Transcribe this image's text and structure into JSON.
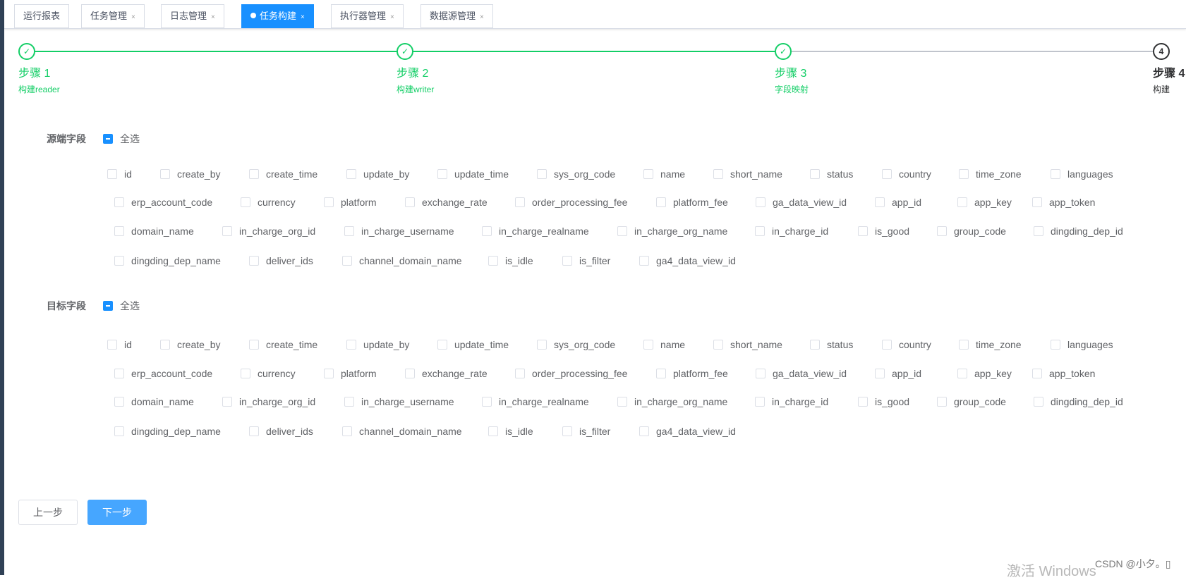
{
  "tabs": [
    {
      "label": "运行报表",
      "closable": false,
      "active": false
    },
    {
      "label": "任务管理",
      "closable": true,
      "active": false
    },
    {
      "label": "日志管理",
      "closable": true,
      "active": false
    },
    {
      "label": "任务构建",
      "closable": true,
      "active": true
    },
    {
      "label": "执行器管理",
      "closable": true,
      "active": false
    },
    {
      "label": "数据源管理",
      "closable": true,
      "active": false
    }
  ],
  "tab_close_glyph": "×",
  "steps": [
    {
      "title": "步骤 1",
      "description": "构建reader",
      "status": "finish"
    },
    {
      "title": "步骤 2",
      "description": "构建writer",
      "status": "finish"
    },
    {
      "title": "步骤 3",
      "description": "字段映射",
      "status": "finish"
    },
    {
      "title": "步骤 4",
      "description": "构建",
      "status": "process",
      "number": "4"
    }
  ],
  "colors": {
    "success": "#13ce66",
    "primary": "#1890ff",
    "button_primary": "#46a6ff"
  },
  "source": {
    "label": "源端字段",
    "check_all_label": "全选",
    "check_all_state": "indeterminate",
    "fields": [
      [
        "id",
        "create_by",
        "create_time",
        "update_by",
        "update_time",
        "sys_org_code",
        "name",
        "short_name",
        "status",
        "country",
        "time_zone",
        "languages"
      ],
      [
        "erp_account_code",
        "currency",
        "platform",
        "exchange_rate",
        "order_processing_fee",
        "platform_fee",
        "ga_data_view_id",
        "app_id",
        "app_key",
        "app_token"
      ],
      [
        "domain_name",
        "in_charge_org_id",
        "in_charge_username",
        "in_charge_realname",
        "in_charge_org_name",
        "in_charge_id",
        "is_good",
        "group_code",
        "dingding_dep_id"
      ],
      [
        "dingding_dep_name",
        "deliver_ids",
        "channel_domain_name",
        "is_idle",
        "is_filter",
        "ga4_data_view_id"
      ]
    ]
  },
  "target": {
    "label": "目标字段",
    "check_all_label": "全选",
    "check_all_state": "indeterminate",
    "fields": [
      [
        "id",
        "create_by",
        "create_time",
        "update_by",
        "update_time",
        "sys_org_code",
        "name",
        "short_name",
        "status",
        "country",
        "time_zone",
        "languages"
      ],
      [
        "erp_account_code",
        "currency",
        "platform",
        "exchange_rate",
        "order_processing_fee",
        "platform_fee",
        "ga_data_view_id",
        "app_id",
        "app_key",
        "app_token"
      ],
      [
        "domain_name",
        "in_charge_org_id",
        "in_charge_username",
        "in_charge_realname",
        "in_charge_org_name",
        "in_charge_id",
        "is_good",
        "group_code",
        "dingding_dep_id"
      ],
      [
        "dingding_dep_name",
        "deliver_ids",
        "channel_domain_name",
        "is_idle",
        "is_filter",
        "ga4_data_view_id"
      ]
    ]
  },
  "buttons": {
    "prev": "上一步",
    "next": "下一步"
  },
  "watermarks": {
    "windows": "激活 Windows",
    "csdn": "CSDN @小夕。▯"
  }
}
